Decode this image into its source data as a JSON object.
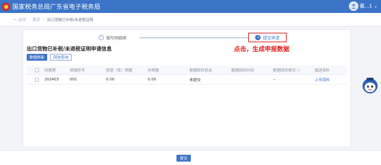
{
  "header": {
    "app_title": "国家税务总局广东省电子税务局",
    "user_name": "戴...1"
  },
  "breadcrumb": {
    "back_label": "返回",
    "items": [
      "首页",
      "出口货物已补税/未退税证明"
    ]
  },
  "steps": [
    {
      "label": "填写明细表",
      "number": "",
      "state": "done"
    },
    {
      "label": "提交申请",
      "number": "2",
      "state": "active"
    }
  ],
  "form": {
    "title": "出口货物已补税/未退税证明申请信息"
  },
  "annotation": "点击，生成申报数据",
  "actions": {
    "refresh_label": "数据刷新",
    "status_query_label": "回信查询"
  },
  "table": {
    "headers": [
      "所属期",
      "明细序号",
      "原退（免）税额",
      "补税额",
      "数据回传状态",
      "数据回传时间",
      "数据回传情况",
      "报送资料"
    ],
    "rows": [
      {
        "period": "202403",
        "seq": "001",
        "refund": "0.00",
        "supplement": "0.00",
        "status": "未提交",
        "time": "",
        "info": "--",
        "materials": "上传资料"
      }
    ]
  },
  "submit_label": "提交",
  "colors": {
    "brand": "#3b74c7",
    "annotation": "#e22020"
  }
}
